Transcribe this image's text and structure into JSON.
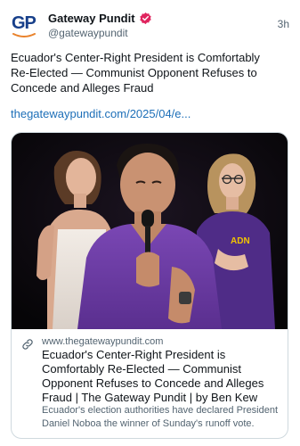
{
  "post": {
    "author": {
      "display_name": "Gateway Pundit",
      "handle": "@gatewaypundit",
      "avatar_initials": "GP",
      "verified": true,
      "badge_icon": "verified-badge-icon",
      "badge_color": "#e0245e"
    },
    "timestamp": "3h",
    "text": "Ecuador's Center-Right President is Comfortably Re-Elected — Communist Opponent Refuses to Concede and Alleges Fraud",
    "link_text": "thegatewaypundit.com/2025/04/e...",
    "link_color": "#1d6fb8"
  },
  "link_card": {
    "domain": "www.thegatewaypundit.com",
    "title": "Ecuador's Center-Right President is Comfortably Re-Elected — Communist Opponent Refuses to Concede and Alleges Fraud | The Gateway Pundit | by Ben Kew",
    "description": "Ecuador's election authorities have declared President Daniel Noboa the winner of Sunday's runoff vote.",
    "icon": "link-icon",
    "image_logo_text": "ADN"
  },
  "colors": {
    "brand_blue": "#173f8a",
    "brand_orange": "#e9822b",
    "shirt_purple": "#6d3fa3"
  }
}
